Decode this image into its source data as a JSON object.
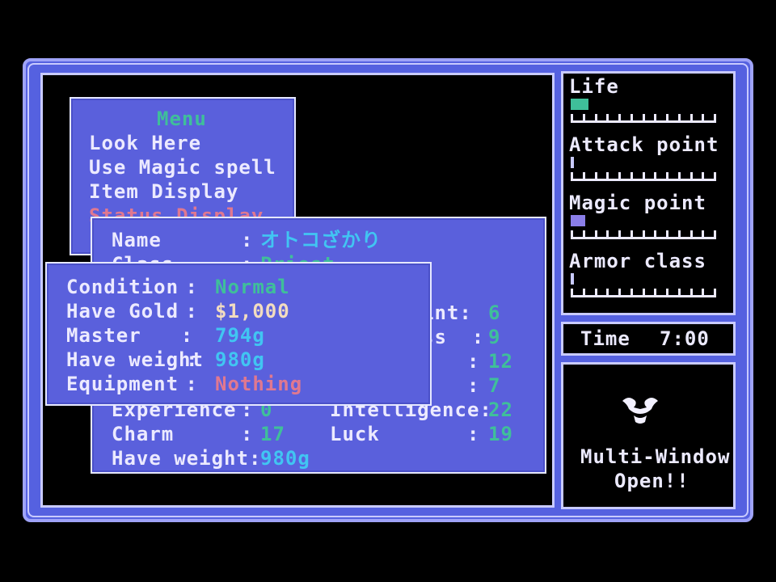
{
  "menu": {
    "title": "Menu",
    "items": [
      "Look Here",
      "Use Magic spell",
      "Item Display",
      "Status Display"
    ]
  },
  "status": {
    "name_label": "Name",
    "name_value": "オトコざかり",
    "class_label": "Class",
    "class_value": "Priest",
    "right_partial": [
      {
        "label": "int:",
        "value": "6"
      },
      {
        "label": "ss  :",
        "value": "9"
      },
      {
        "label": ":",
        "value": "12"
      },
      {
        "label": ":",
        "value": "7"
      }
    ],
    "experience_label": "Experience",
    "experience_value": "0",
    "intelligence_label": "Intelligence:",
    "intelligence_value": "22",
    "charm_label": "Charm",
    "charm_value": "17",
    "luck_label": "Luck",
    "luck_value": "19",
    "weight_label": "Have weight:",
    "weight_value": "980g"
  },
  "inventory": {
    "rows": [
      {
        "label": "Condition",
        "sep": " : ",
        "value": "Normal"
      },
      {
        "label": "Have Gold",
        "sep": " : ",
        "value": "$1,000"
      },
      {
        "label": "Master",
        "sep": "    : ",
        "value": "794g"
      },
      {
        "label": "Have weight",
        "sep": ": ",
        "value": "980g"
      },
      {
        "label": "Equipment",
        "sep": " : ",
        "value": "Nothing"
      }
    ]
  },
  "gauges": {
    "life": {
      "label": "Life",
      "level": 0.12,
      "color": "#3fbf9a"
    },
    "attack": {
      "label": "Attack point",
      "level": 0.02,
      "color": "#c9cbff"
    },
    "magic": {
      "label": "Magic point",
      "level": 0.1,
      "color": "#8a7ee8"
    },
    "armor": {
      "label": "Armor class",
      "level": 0.02,
      "color": "#c9cbff"
    }
  },
  "time": {
    "label": "Time",
    "value": "7:00"
  },
  "banner": {
    "line1": "Multi-Window",
    "line2": "Open!!",
    "icon": "winged-emblem-icon"
  },
  "colors": {
    "frame": "#5561e0",
    "window": "#5a60dc",
    "text": "#eceaff",
    "green": "#3fbf9a",
    "cyan": "#41c5f2",
    "red": "#e07890"
  }
}
